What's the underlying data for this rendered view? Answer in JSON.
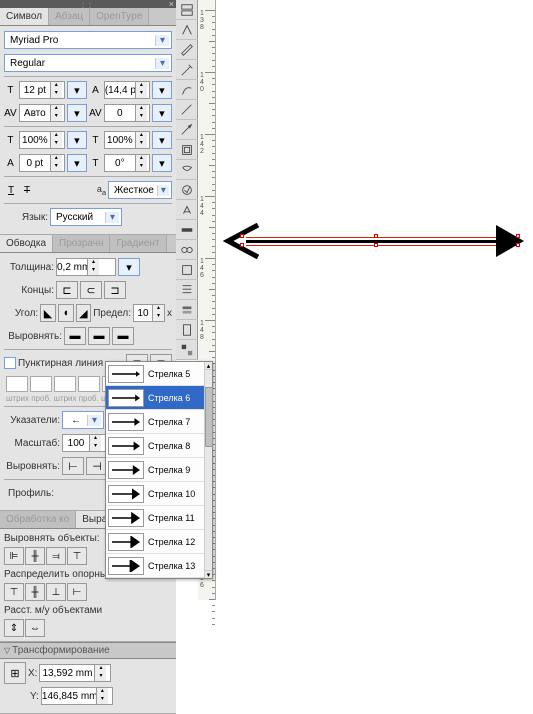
{
  "panels": {
    "char": {
      "tabs": [
        "Символ",
        "Абзац",
        "OpenType"
      ],
      "font_family": "Myriad Pro",
      "font_style": "Regular",
      "size_label": "12 pt",
      "leading_label": "(14,4 pt",
      "kerning": "Авто",
      "tracking": "0",
      "vscale": "100%",
      "hscale": "100%",
      "baseline": "0 pt",
      "rotation": "0°",
      "aa_label": "Жесткое",
      "lang_label": "Язык:",
      "lang_value": "Русский"
    },
    "stroke": {
      "tabs": [
        "Обводка",
        "Прозрачн",
        "Градиент"
      ],
      "weight_label": "Толщина:",
      "weight_value": "0,2 mm",
      "caps_label": "Концы:",
      "angle_label": "Угол:",
      "limit_label": "Предел:",
      "limit_value": "10",
      "align_label": "Выровнять:",
      "dash_label": "Пунктирная линия",
      "dash_caption": "штрих проб. штрих проб. штрих проб.",
      "markers_label": "Указатели:",
      "scale_label": "Масштаб:",
      "scale_value": "100",
      "align2_label": "Выровнять:",
      "profile_label": "Профиль:"
    },
    "align": {
      "tabs": [
        "Обработка ко",
        "Выра"
      ],
      "align_obj_label": "Выровнять объекты:",
      "distribute_label": "Распределить опорные",
      "spacing_label": "Расст. м/у объектами"
    },
    "transform": {
      "title": "Трансформирование",
      "x_label": "X:",
      "y_label": "Y:",
      "x_value": "13,592 mm",
      "y_value": "146,845 mm"
    }
  },
  "popup": {
    "items": [
      {
        "label": "Стрелка 5",
        "selected": false
      },
      {
        "label": "Стрелка 6",
        "selected": true
      },
      {
        "label": "Стрелка 7",
        "selected": false
      },
      {
        "label": "Стрелка 8",
        "selected": false
      },
      {
        "label": "Стрелка 9",
        "selected": false
      },
      {
        "label": "Стрелка 10",
        "selected": false
      },
      {
        "label": "Стрелка 11",
        "selected": false
      },
      {
        "label": "Стрелка 12",
        "selected": false
      },
      {
        "label": "Стрелка 13",
        "selected": false
      }
    ]
  },
  "ruler": {
    "start": 138,
    "end": 156,
    "step": 2
  },
  "chart_data": null
}
